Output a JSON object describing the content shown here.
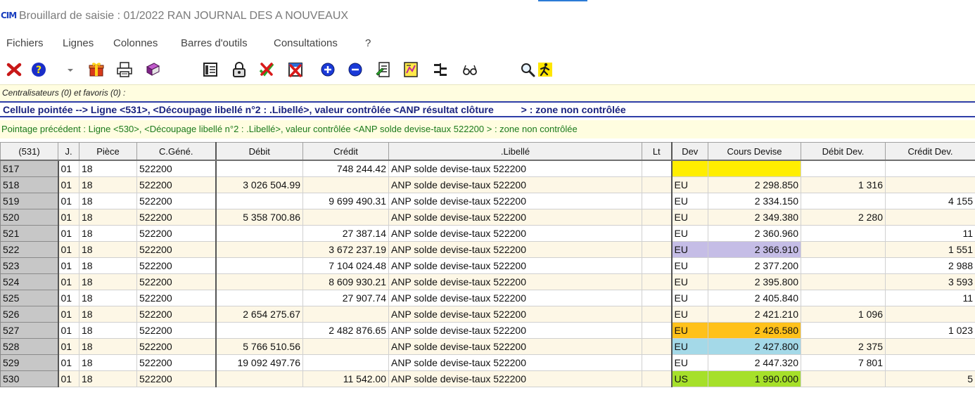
{
  "window": {
    "title": "Brouillard de saisie : 01/2022 RAN JOURNAL DES A NOUVEAUX",
    "logo_text": "CIM"
  },
  "menu": [
    "Fichiers",
    "Lignes",
    "Colonnes",
    "Barres d'outils",
    "Consultations",
    "?"
  ],
  "toolbar_icons": [
    "close-icon",
    "help-icon",
    "dropdown-arrow-icon",
    "gift-icon",
    "printer-icon",
    "book-icon",
    "table-icon",
    "lock-icon",
    "delete-check-icon",
    "delete-box-icon",
    "add-circle-icon",
    "remove-circle-icon",
    "edit-list-icon",
    "report-icon",
    "structure-icon",
    "glasses-icon",
    "search-icon",
    "run-icon"
  ],
  "favorites": {
    "text": "Centralisateurs (0) et favoris (0) :"
  },
  "cell_info": {
    "text": "Cellule pointée --> Ligne <531>, <Découpage libellé n°2 : .Libellé>, valeur contrôlée <ANP résultat clôture          > : zone non contrôlée"
  },
  "previous_info": {
    "text": "Pointage précédent  :  Ligne <530>, <Découpage libellé n°2 : .Libellé>, valeur contrôlée <ANP solde devise-taux 522200 > : zone non contrôlée"
  },
  "colors": {
    "yellow": "#ffee00",
    "lavender": "#c5bde6",
    "orange": "#ffc11a",
    "lightblue": "#a4d9e8",
    "green": "#a6e02a"
  },
  "table": {
    "headers": [
      "(531)",
      "J.",
      "Pièce",
      "C.Géné.",
      "Débit",
      "Crédit",
      ".Libellé",
      "Lt",
      "Dev",
      "Cours Devise",
      "Débit Dev.",
      "Crédit Dev."
    ],
    "rows": [
      {
        "num": "517",
        "j": "01",
        "piece": "18",
        "compte": "522200",
        "debit": "",
        "credit": "748 244.42",
        "libelle": "ANP solde devise-taux 522200",
        "lt": "",
        "dev": "",
        "cours": "",
        "debit_dev": "",
        "credit_dev": "",
        "highlight": "yellow"
      },
      {
        "num": "518",
        "j": "01",
        "piece": "18",
        "compte": "522200",
        "debit": "3 026 504.99",
        "credit": "",
        "libelle": "ANP solde devise-taux 522200",
        "lt": "",
        "dev": "EU",
        "cours": "2 298.850",
        "debit_dev": "1 316",
        "credit_dev": "",
        "highlight": ""
      },
      {
        "num": "519",
        "j": "01",
        "piece": "18",
        "compte": "522200",
        "debit": "",
        "credit": "9 699 490.31",
        "libelle": "ANP solde devise-taux 522200",
        "lt": "",
        "dev": "EU",
        "cours": "2 334.150",
        "debit_dev": "",
        "credit_dev": "4 155",
        "highlight": ""
      },
      {
        "num": "520",
        "j": "01",
        "piece": "18",
        "compte": "522200",
        "debit": "5 358 700.86",
        "credit": "",
        "libelle": "ANP solde devise-taux 522200",
        "lt": "",
        "dev": "EU",
        "cours": "2 349.380",
        "debit_dev": "2 280",
        "credit_dev": "",
        "highlight": ""
      },
      {
        "num": "521",
        "j": "01",
        "piece": "18",
        "compte": "522200",
        "debit": "",
        "credit": "27 387.14",
        "libelle": "ANP solde devise-taux 522200",
        "lt": "",
        "dev": "EU",
        "cours": "2 360.960",
        "debit_dev": "",
        "credit_dev": "11",
        "highlight": ""
      },
      {
        "num": "522",
        "j": "01",
        "piece": "18",
        "compte": "522200",
        "debit": "",
        "credit": "3 672 237.19",
        "libelle": "ANP solde devise-taux 522200",
        "lt": "",
        "dev": "EU",
        "cours": "2 366.910",
        "debit_dev": "",
        "credit_dev": "1 551",
        "highlight": "lavender"
      },
      {
        "num": "523",
        "j": "01",
        "piece": "18",
        "compte": "522200",
        "debit": "",
        "credit": "7 104 024.48",
        "libelle": "ANP solde devise-taux 522200",
        "lt": "",
        "dev": "EU",
        "cours": "2 377.200",
        "debit_dev": "",
        "credit_dev": "2 988",
        "highlight": ""
      },
      {
        "num": "524",
        "j": "01",
        "piece": "18",
        "compte": "522200",
        "debit": "",
        "credit": "8 609 930.21",
        "libelle": "ANP solde devise-taux 522200",
        "lt": "",
        "dev": "EU",
        "cours": "2 395.800",
        "debit_dev": "",
        "credit_dev": "3 593",
        "highlight": ""
      },
      {
        "num": "525",
        "j": "01",
        "piece": "18",
        "compte": "522200",
        "debit": "",
        "credit": "27 907.74",
        "libelle": "ANP solde devise-taux 522200",
        "lt": "",
        "dev": "EU",
        "cours": "2 405.840",
        "debit_dev": "",
        "credit_dev": "11",
        "highlight": ""
      },
      {
        "num": "526",
        "j": "01",
        "piece": "18",
        "compte": "522200",
        "debit": "2 654 275.67",
        "credit": "",
        "libelle": "ANP solde devise-taux 522200",
        "lt": "",
        "dev": "EU",
        "cours": "2 421.210",
        "debit_dev": "1 096",
        "credit_dev": "",
        "highlight": ""
      },
      {
        "num": "527",
        "j": "01",
        "piece": "18",
        "compte": "522200",
        "debit": "",
        "credit": "2 482 876.65",
        "libelle": "ANP solde devise-taux 522200",
        "lt": "",
        "dev": "EU",
        "cours": "2 426.580",
        "debit_dev": "",
        "credit_dev": "1 023",
        "highlight": "orange"
      },
      {
        "num": "528",
        "j": "01",
        "piece": "18",
        "compte": "522200",
        "debit": "5 766 510.56",
        "credit": "",
        "libelle": "ANP solde devise-taux 522200",
        "lt": "",
        "dev": "EU",
        "cours": "2 427.800",
        "debit_dev": "2 375",
        "credit_dev": "",
        "highlight": "lightblue"
      },
      {
        "num": "529",
        "j": "01",
        "piece": "18",
        "compte": "522200",
        "debit": "19 092 497.76",
        "credit": "",
        "libelle": "ANP solde devise-taux 522200",
        "lt": "",
        "dev": "EU",
        "cours": "2 447.320",
        "debit_dev": "7 801",
        "credit_dev": "",
        "highlight": ""
      },
      {
        "num": "530",
        "j": "01",
        "piece": "18",
        "compte": "522200",
        "debit": "",
        "credit": "11 542.00",
        "libelle": "ANP solde devise-taux 522200",
        "lt": "",
        "dev": "US",
        "cours": "1 990.000",
        "debit_dev": "",
        "credit_dev": "5",
        "highlight": "green"
      }
    ]
  }
}
